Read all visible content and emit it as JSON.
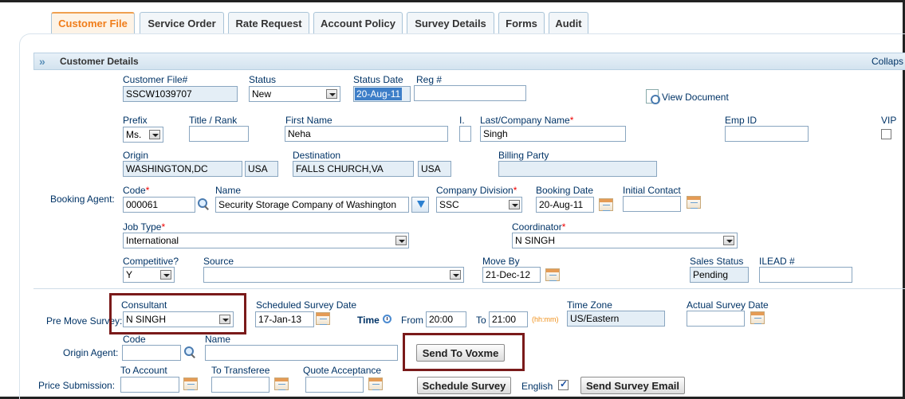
{
  "tabs": [
    "Customer File",
    "Service Order",
    "Rate Request",
    "Account Policy",
    "Survey Details",
    "Forms",
    "Audit"
  ],
  "header": {
    "title": "Customer Details",
    "collapse": "Collaps"
  },
  "row1": {
    "customer_file_label": "Customer File#",
    "customer_file": "SSCW1039707",
    "status_label": "Status",
    "status": "New",
    "status_date_label": "Status Date",
    "status_date": "20-Aug-11",
    "reg_label": "Reg #",
    "reg": "",
    "view_document": "View Document"
  },
  "row2": {
    "prefix_label": "Prefix",
    "prefix": "Ms.",
    "title_label": "Title / Rank",
    "title": "",
    "first_name_label": "First Name",
    "first_name": "Neha",
    "initial_label": "I.",
    "initial": "",
    "last_name_label": "Last/Company Name",
    "last_name": "Singh",
    "emp_id_label": "Emp ID",
    "emp_id": "",
    "vip_label": "VIP"
  },
  "row3": {
    "origin_label": "Origin",
    "origin": "WASHINGTON,DC",
    "origin_country": "USA",
    "destination_label": "Destination",
    "destination": "FALLS CHURCH,VA",
    "destination_country": "USA",
    "billing_label": "Billing Party",
    "billing": ""
  },
  "row4": {
    "booking_agent_label": "Booking Agent:",
    "code_label": "Code",
    "code": "000061",
    "name_label": "Name",
    "name": "Security Storage Company of Washington",
    "division_label": "Company Division",
    "division": "SSC",
    "booking_date_label": "Booking Date",
    "booking_date": "20-Aug-11",
    "initial_contact_label": "Initial Contact",
    "initial_contact": ""
  },
  "row5": {
    "job_type_label": "Job Type",
    "job_type": "International",
    "coordinator_label": "Coordinator",
    "coordinator": "N SINGH"
  },
  "row6": {
    "competitive_label": "Competitive?",
    "competitive": "Y",
    "source_label": "Source",
    "source": "",
    "move_by_label": "Move By",
    "move_by": "21-Dec-12",
    "sales_status_label": "Sales Status",
    "sales_status": "Pending",
    "ilead_label": "ILEAD #",
    "ilead": ""
  },
  "survey": {
    "pre_move_label": "Pre Move Survey:",
    "consultant_label": "Consultant",
    "consultant": "N SINGH",
    "scheduled_label": "Scheduled Survey Date",
    "scheduled": "17-Jan-13",
    "time_label": "Time",
    "from_label": "From",
    "from": "20:00",
    "to_label": "To",
    "to": "21:00",
    "hhmm": "(hh:mm)",
    "tz_label": "Time Zone",
    "tz": "US/Eastern",
    "actual_label": "Actual Survey Date",
    "actual": ""
  },
  "origin_agent": {
    "label": "Origin Agent:",
    "code_label": "Code",
    "code": "",
    "name_label": "Name",
    "name": "",
    "send_voxme": "Send To Voxme"
  },
  "price": {
    "label": "Price Submission:",
    "to_account_label": "To Account",
    "to_account": "",
    "to_transferee_label": "To Transferee",
    "to_transferee": "",
    "quote_label": "Quote Acceptance",
    "quote": "",
    "schedule_survey": "Schedule Survey",
    "english": "English",
    "send_survey_email": "Send Survey Email"
  }
}
